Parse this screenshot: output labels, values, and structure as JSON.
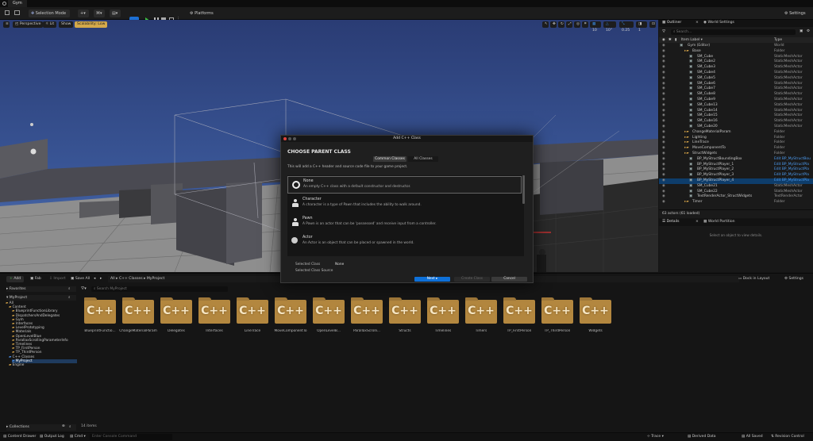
{
  "window": {
    "tab": "Gym"
  },
  "toolbar": {
    "selection_mode": "Selection Mode",
    "platforms": "Platforms",
    "settings": "Settings"
  },
  "viewport": {
    "perspective": "Perspective",
    "lit": "Lit",
    "show": "Show",
    "scalability": "Scalability: Low",
    "grid": "10",
    "angle": "10°",
    "scale": "0.25",
    "cams": "1",
    "colors": {
      "scalability_bg": "#d4a94a",
      "sky": "#2c4a86",
      "floor": "#8d8d8d"
    }
  },
  "outliner": {
    "tab_outliner": "Outliner",
    "tab_world": "World Settings",
    "search_placeholder": "Search...",
    "col_label": "Item Label",
    "col_type": "Type",
    "rows": [
      {
        "name": "Gym (Editor)",
        "type": "World",
        "indent": 0
      },
      {
        "name": "Base",
        "type": "Folder",
        "indent": 1
      },
      {
        "name": "SM_Cube",
        "type": "StaticMeshActor",
        "indent": 2
      },
      {
        "name": "SM_Cube2",
        "type": "StaticMeshActor",
        "indent": 2
      },
      {
        "name": "SM_Cube3",
        "type": "StaticMeshActor",
        "indent": 2
      },
      {
        "name": "SM_Cube4",
        "type": "StaticMeshActor",
        "indent": 2
      },
      {
        "name": "SM_Cube5",
        "type": "StaticMeshActor",
        "indent": 2
      },
      {
        "name": "SM_Cube6",
        "type": "StaticMeshActor",
        "indent": 2
      },
      {
        "name": "SM_Cube7",
        "type": "StaticMeshActor",
        "indent": 2
      },
      {
        "name": "SM_Cube8",
        "type": "StaticMeshActor",
        "indent": 2
      },
      {
        "name": "SM_Cube9",
        "type": "StaticMeshActor",
        "indent": 2
      },
      {
        "name": "SM_Cube13",
        "type": "StaticMeshActor",
        "indent": 2
      },
      {
        "name": "SM_Cube14",
        "type": "StaticMeshActor",
        "indent": 2
      },
      {
        "name": "SM_Cube15",
        "type": "StaticMeshActor",
        "indent": 2
      },
      {
        "name": "SM_Cube16",
        "type": "StaticMeshActor",
        "indent": 2
      },
      {
        "name": "SM_Cube20",
        "type": "StaticMeshActor",
        "indent": 2
      },
      {
        "name": "ChangeMaterialParam",
        "type": "Folder",
        "indent": 1
      },
      {
        "name": "Lighting",
        "type": "Folder",
        "indent": 1
      },
      {
        "name": "LineTrace",
        "type": "Folder",
        "indent": 1
      },
      {
        "name": "MoveComponentTo",
        "type": "Folder",
        "indent": 1
      },
      {
        "name": "StructWidgets",
        "type": "Folder",
        "indent": 1
      },
      {
        "name": "BP_MyStructBoundingBox",
        "type": "Edit BP_MyStructBou",
        "indent": 2,
        "link": true
      },
      {
        "name": "BP_MyStructPlayer_1",
        "type": "Edit BP_MyStructPla",
        "indent": 2,
        "link": true
      },
      {
        "name": "BP_MyStructPlayer_2",
        "type": "Edit BP_MyStructPla",
        "indent": 2,
        "link": true
      },
      {
        "name": "BP_MyStructPlayer_3",
        "type": "Edit BP_MyStructPla",
        "indent": 2,
        "link": true
      },
      {
        "name": "BP_MyStructPlayer_4",
        "type": "Edit BP_MyStructPla",
        "indent": 2,
        "link": true,
        "selected": true
      },
      {
        "name": "SM_Cube21",
        "type": "StaticMeshActor",
        "indent": 2
      },
      {
        "name": "SM_Cube22",
        "type": "StaticMeshActor",
        "indent": 2
      },
      {
        "name": "TextRenderActor_StructWidgets",
        "type": "TextRenderActor",
        "indent": 2
      },
      {
        "name": "Timer",
        "type": "Folder",
        "indent": 1
      }
    ],
    "actor_count": "63 actors (61 loaded)"
  },
  "details": {
    "tab_details": "Details",
    "tab_partition": "World Partition",
    "empty_msg": "Select an object to view details."
  },
  "content_browser": {
    "add": "Add",
    "fab": "Fab",
    "import": "Import",
    "save_all": "Save All",
    "path": [
      "All",
      "C++ Classes",
      "MyProject"
    ],
    "dock": "Dock in Layout",
    "settings": "Settings",
    "search_placeholder": "Search MyProject",
    "favorites": "Favorites",
    "project": "MyProject",
    "folders": [
      {
        "name": "All",
        "indent": 0
      },
      {
        "name": "Content",
        "indent": 1
      },
      {
        "name": "BlueprintFunctionLibrary",
        "indent": 2
      },
      {
        "name": "DispatchersAndDelegates",
        "indent": 2
      },
      {
        "name": "Gym",
        "indent": 2
      },
      {
        "name": "Interfaces",
        "indent": 2
      },
      {
        "name": "LevelPrototyping",
        "indent": 2
      },
      {
        "name": "Materials",
        "indent": 2
      },
      {
        "name": "OpenLevelBlue",
        "indent": 2
      },
      {
        "name": "ParallaxScrollingParameterInfo",
        "indent": 2
      },
      {
        "name": "Timelines",
        "indent": 2
      },
      {
        "name": "TP_FirstPerson",
        "indent": 2
      },
      {
        "name": "TP_ThirdPerson",
        "indent": 2
      },
      {
        "name": "C++ Classes",
        "indent": 1
      },
      {
        "name": "MyProject",
        "indent": 2,
        "selected": true
      },
      {
        "name": "Engine",
        "indent": 1
      }
    ],
    "items": [
      "BlueprintFunctio...",
      "ChangeMaterialParam",
      "Delegates",
      "Interfaces",
      "LineTrace",
      "MoveComponentTo",
      "OpenLevelB...",
      "ParallaxScrolli...",
      "Structs",
      "Timelines",
      "Timers",
      "TP_FirstPerson",
      "TP_ThirdPerson",
      "Widgets"
    ],
    "cpp_glyph": "C++",
    "item_count": "14 items",
    "collections": "Collections"
  },
  "statusbar": {
    "content_drawer": "Content Drawer",
    "output_log": "Output Log",
    "cmd": "Cmd",
    "console_placeholder": "Enter Console Command",
    "trace": "Trace",
    "derived": "Derived Data",
    "all_saved": "All Saved",
    "revision": "Revision Control"
  },
  "modal": {
    "title": "Add C++ Class",
    "heading": "CHOOSE PARENT CLASS",
    "tab_common": "Common Classes",
    "tab_all": "All Classes",
    "intro": "This will add a C++ header and source code file to your game project.",
    "options": [
      {
        "name": "None",
        "desc": "An empty C++ class with a default constructor and destructor.",
        "icon": "circle-icon"
      },
      {
        "name": "Character",
        "desc": "A character is a type of Pawn that includes the ability to walk around.",
        "icon": "character-icon"
      },
      {
        "name": "Pawn",
        "desc": "A Pawn is an actor that can be 'possessed' and receive input from a controller.",
        "icon": "pawn-icon"
      },
      {
        "name": "Actor",
        "desc": "An Actor is an object that can be placed or spawned in the world.",
        "icon": "actor-icon"
      }
    ],
    "selected_class_label": "Selected Class",
    "selected_class_value": "None",
    "selected_source_label": "Selected Class Source",
    "next": "Next ▸",
    "create": "Create Class",
    "cancel": "Cancel",
    "colors": {
      "primary": "#0e70d8"
    }
  }
}
